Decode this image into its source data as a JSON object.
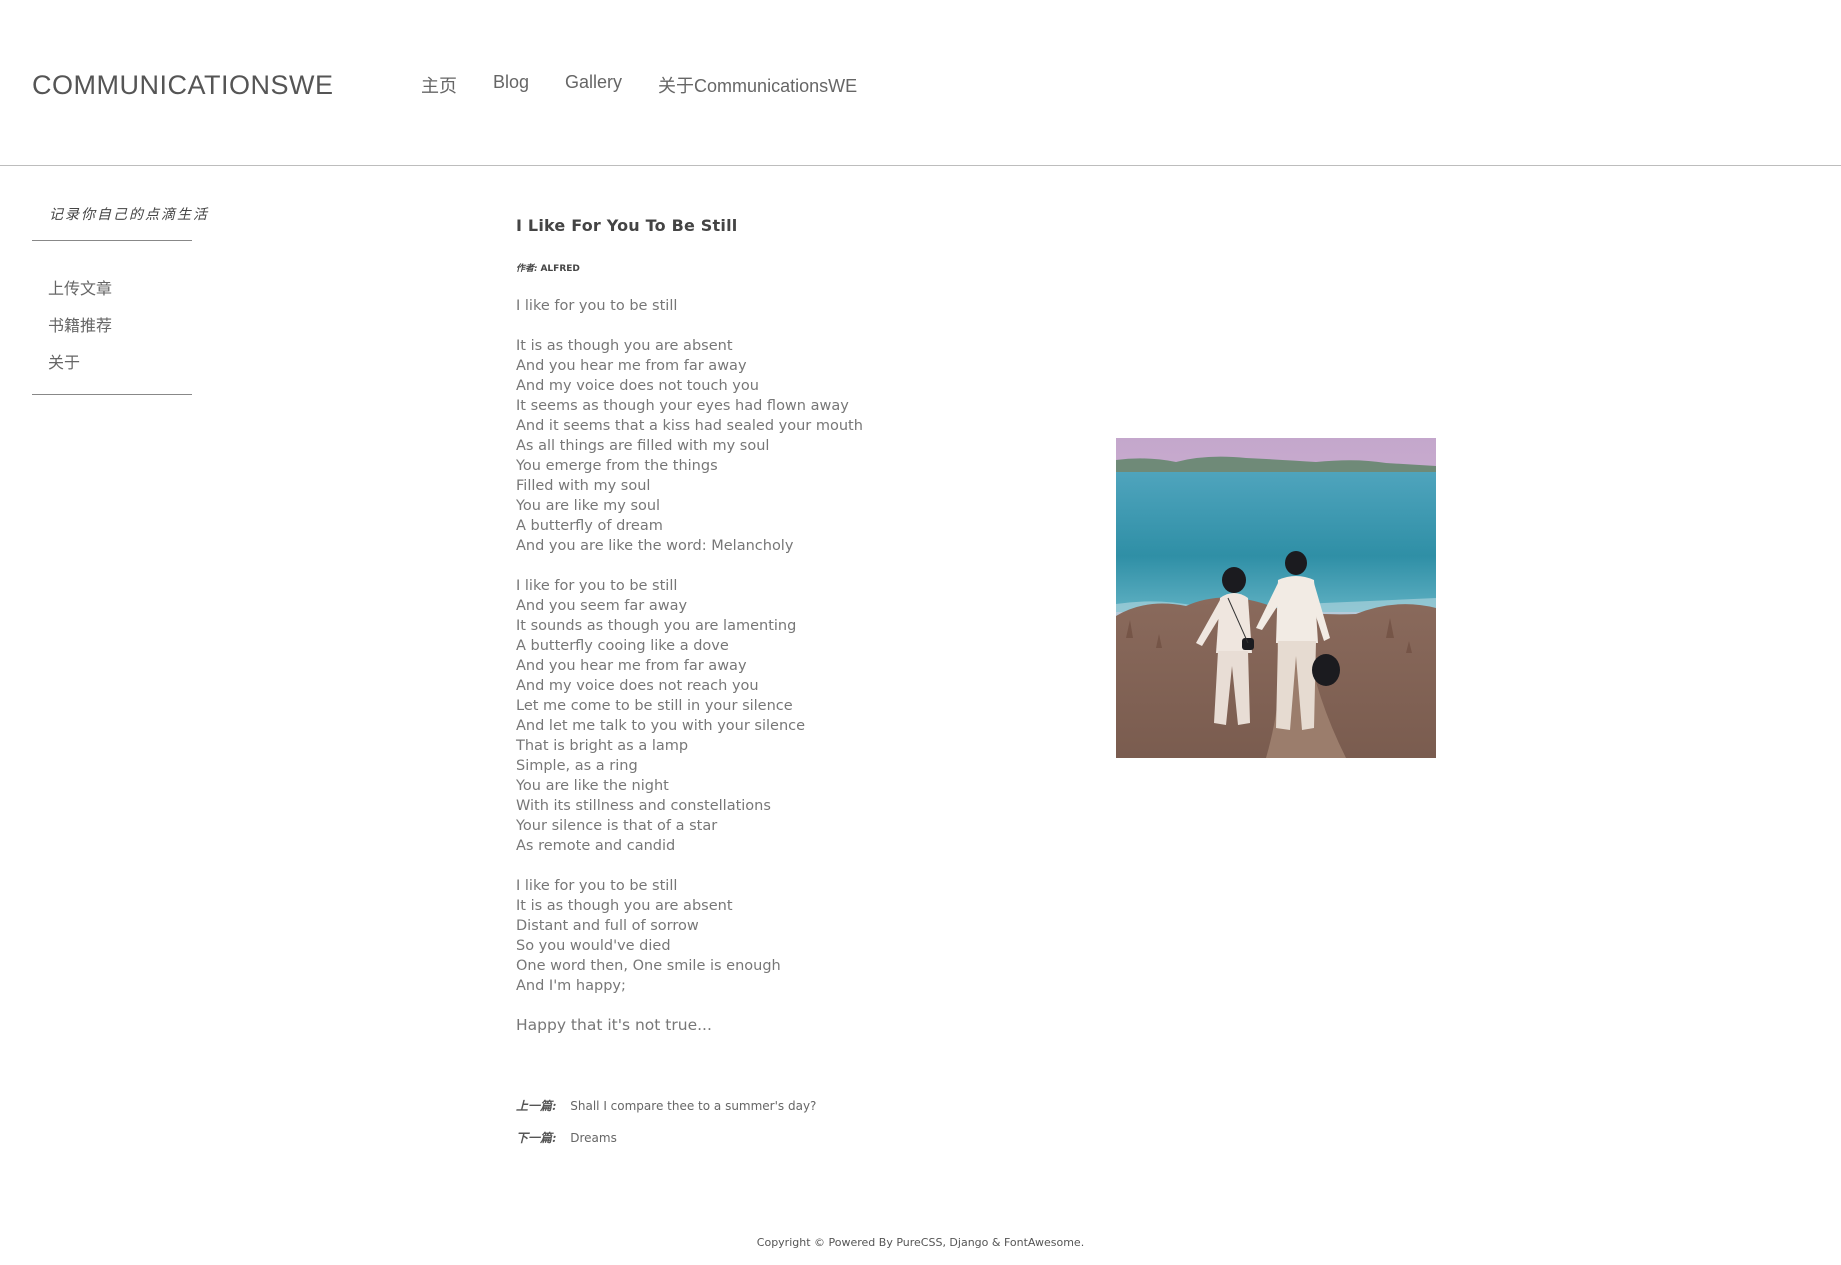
{
  "header": {
    "brand": "COMMUNICATIONSWE",
    "nav": [
      {
        "label": "主页"
      },
      {
        "label": "Blog"
      },
      {
        "label": "Gallery"
      },
      {
        "label": "关于CommunicationsWE"
      }
    ]
  },
  "sidebar": {
    "title": "记录你自己的点滴生活",
    "items": [
      {
        "label": "上传文章"
      },
      {
        "label": "书籍推荐"
      },
      {
        "label": "关于"
      }
    ]
  },
  "post": {
    "title": "I Like For You To Be Still",
    "author_label": "作者:",
    "author": "ALFRED",
    "stanzas": [
      [
        "I like for you to be still"
      ],
      [
        "It is as though you are absent",
        "And you hear me from far away",
        "And my voice does not touch you",
        "It seems as though your eyes had flown away",
        "And it seems that a kiss had sealed your mouth",
        "As all things are filled with my soul",
        "You emerge from the things",
        "Filled with my soul",
        "You are like my soul",
        "A butterfly of dream",
        "And you are like the word: Melancholy"
      ],
      [
        "I like for you to be still",
        "And you seem far away",
        "It sounds as though you are lamenting",
        "A butterfly cooing like a dove",
        "And you hear me from far away",
        "And my voice does not reach you",
        "Let me come to be still in your silence",
        "And let me talk to you with your silence",
        "That is bright as a lamp",
        "Simple, as a ring",
        "You are like the night",
        "With its stillness and constellations",
        "Your silence is that of a star",
        "As remote and candid"
      ],
      [
        "I like for you to be still",
        "It is as though you are absent",
        "Distant and full of sorrow",
        "So you would've died",
        "One word then, One smile is enough",
        "And I'm happy;"
      ]
    ],
    "ending": "Happy that it's not true...",
    "prev_label": "上一篇:",
    "prev_title": "Shall I compare thee to a summer's day?",
    "next_label": "下一篇:",
    "next_title": "Dreams"
  },
  "footer": {
    "text": "Copyright © Powered By PureCSS, Django & FontAwesome."
  }
}
